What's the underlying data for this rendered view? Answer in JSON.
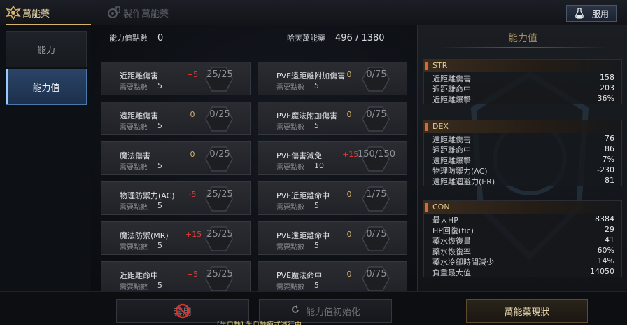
{
  "tabs": {
    "main_tab": "萬能藥",
    "craft_tab": "製作萬能藥",
    "use_button": "服用"
  },
  "nav": {
    "items": [
      {
        "label": "能力"
      },
      {
        "label": "能力值"
      }
    ]
  },
  "points": {
    "label": "能力值點數",
    "value": "0",
    "elixir_label": "哈芙萬能藥",
    "elixir_value": "496 / 1380"
  },
  "left_cards": [
    {
      "name": "近距離傷害",
      "req_label": "需要點數",
      "req": "5",
      "add": "+5",
      "value": "25/25"
    },
    {
      "name": "遠距離傷害",
      "req_label": "需要點數",
      "req": "5",
      "add": "0",
      "value": "0/25"
    },
    {
      "name": "魔法傷害",
      "req_label": "需要點數",
      "req": "5",
      "add": "0",
      "value": "0/25"
    },
    {
      "name": "物理防禦力(AC)",
      "req_label": "需要點數",
      "req": "5",
      "add": "-5",
      "value": "25/25"
    },
    {
      "name": "魔法防禦(MR)",
      "req_label": "需要點數",
      "req": "5",
      "add": "+15",
      "value": "25/25"
    },
    {
      "name": "近距離命中",
      "req_label": "需要點數",
      "req": "5",
      "add": "+5",
      "value": "25/25"
    }
  ],
  "right_cards": [
    {
      "name": "PVE遠距離附加傷害",
      "req_label": "需要點數",
      "req": "5",
      "add": "0",
      "value": "0/75"
    },
    {
      "name": "PVE魔法附加傷害",
      "req_label": "需要點數",
      "req": "5",
      "add": "0",
      "value": "0/75"
    },
    {
      "name": "PVE傷害減免",
      "req_label": "需要點數",
      "req": "10",
      "add": "+15",
      "value": "150/150"
    },
    {
      "name": "PVE近距離命中",
      "req_label": "需要點數",
      "req": "5",
      "add": "0",
      "value": "1/75"
    },
    {
      "name": "PVE遠距離命中",
      "req_label": "需要點數",
      "req": "5",
      "add": "0",
      "value": "0/75"
    },
    {
      "name": "PVE魔法命中",
      "req_label": "需要點數",
      "req": "5",
      "add": "0",
      "value": "0/75"
    }
  ],
  "stats_panel": {
    "title": "能力值",
    "sections": [
      {
        "name": "STR",
        "rows": [
          {
            "k": "近距離傷害",
            "v": "158"
          },
          {
            "k": "近距離命中",
            "v": "203"
          },
          {
            "k": "近距離爆擊",
            "v": "36%"
          }
        ]
      },
      {
        "name": "DEX",
        "rows": [
          {
            "k": "遠距離傷害",
            "v": "76"
          },
          {
            "k": "遠距離命中",
            "v": "86"
          },
          {
            "k": "遠距離爆擊",
            "v": "7%"
          },
          {
            "k": "物理防禦力(AC)",
            "v": "-230"
          },
          {
            "k": "遠距離迴避力(ER)",
            "v": "81"
          }
        ]
      },
      {
        "name": "CON",
        "rows": [
          {
            "k": "最大HP",
            "v": "8384"
          },
          {
            "k": "HP回復(tic)",
            "v": "29"
          },
          {
            "k": "藥水恢復量",
            "v": "41"
          },
          {
            "k": "藥水恢復率",
            "v": "60%"
          },
          {
            "k": "藥水冷卻時間減少",
            "v": "14%"
          },
          {
            "k": "負重最大值",
            "v": "14050"
          }
        ]
      }
    ]
  },
  "bottom": {
    "apply": "套用",
    "reset": "能力值初始化",
    "status": "萬能藥現狀",
    "ticker": "[半自動] 半自動模式運行中"
  },
  "colors": {
    "gold": "#d6b56a",
    "red": "#e23c32",
    "accent_blue": "#4b78aa"
  }
}
